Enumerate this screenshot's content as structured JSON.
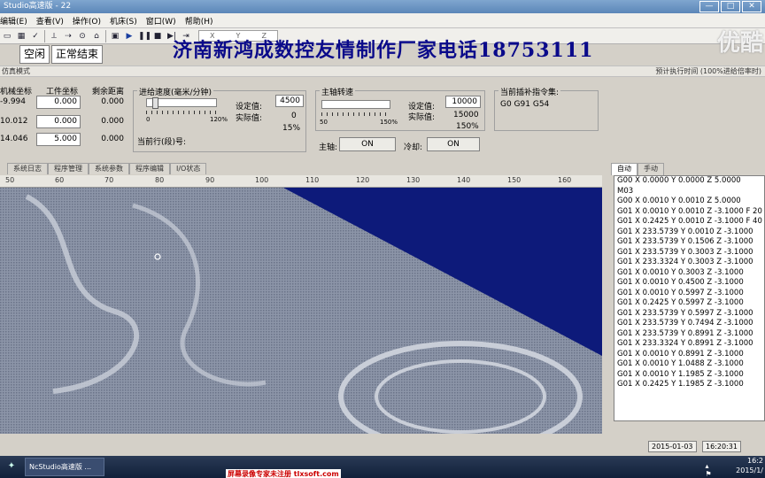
{
  "window": {
    "title": "Studio高速版 - 22",
    "buttons": [
      "—",
      "□",
      "✕"
    ]
  },
  "menu": [
    "编辑(E)",
    "查看(V)",
    "操作(O)",
    "机床(S)",
    "窗口(W)",
    "帮助(H)"
  ],
  "toolbar": {
    "xyz": [
      "X",
      "Y",
      "Z"
    ]
  },
  "status": {
    "idle": "空闲",
    "normal_end": "正常结束"
  },
  "banner": "济南新鸿成数控友情制作厂家电话18753111",
  "watermark": "优酷",
  "mode": {
    "label": "仿真模式",
    "estimate": "预计执行时间 (100%进给倍率时)"
  },
  "coords": {
    "headers": [
      "机械坐标",
      "工件坐标",
      "剩余距离"
    ],
    "rows": [
      {
        "mach": "-9.994",
        "work": "0.000",
        "remain": "0.000"
      },
      {
        "mach": "10.012",
        "work": "0.000",
        "remain": "0.000"
      },
      {
        "mach": "14.046",
        "work": "5.000",
        "remain": "0.000"
      }
    ]
  },
  "feed": {
    "title": "进给速度(毫米/分钟)",
    "set_label": "设定值:",
    "set_value": "4500",
    "actual_label": "实际值:",
    "actual_value": "0",
    "percent": "15%",
    "min": "0",
    "max": "120%",
    "current_line_label": "当前行(段)号:"
  },
  "spindle": {
    "title": "主轴转速",
    "set_label": "设定值:",
    "set_value": "10000",
    "actual_label": "实际值:",
    "actual_value": "15000",
    "percent": "150%",
    "min": "50",
    "max": "150%",
    "spindle_label": "主轴:",
    "spindle_btn": "ON",
    "cool_label": "冷却:",
    "cool_btn": "ON"
  },
  "interp": {
    "title": "当前插补指令集:",
    "value": "G0 G91 G54"
  },
  "tabs_left": [
    "系统日志",
    "程序管理",
    "系统参数",
    "程序编辑",
    "I/O状态"
  ],
  "tabs_right": [
    "自动",
    "手动"
  ],
  "ruler": [
    "50",
    "60",
    "70",
    "80",
    "90",
    "100",
    "110",
    "120",
    "130",
    "140",
    "150",
    "160"
  ],
  "gcode": [
    "G00 X 0.0000 Y 0.0000 Z 5.0000",
    "M03",
    "G00 X 0.0010 Y 0.0010 Z 5.0000",
    "G01 X 0.0010 Y 0.0010 Z -3.1000 F 20",
    "G01 X 0.2425 Y 0.0010 Z -3.1000 F 40",
    "G01 X 233.5739 Y 0.0010 Z -3.1000",
    "G01 X 233.5739 Y 0.1506 Z -3.1000",
    "G01 X 233.5739 Y 0.3003 Z -3.1000",
    "G01 X 233.3324 Y 0.3003 Z -3.1000",
    "G01 X 0.0010 Y 0.3003 Z -3.1000",
    "G01 X 0.0010 Y 0.4500 Z -3.1000",
    "G01 X 0.0010 Y 0.5997 Z -3.1000",
    "G01 X 0.2425 Y 0.5997 Z -3.1000",
    "G01 X 233.5739 Y 0.5997 Z -3.1000",
    "G01 X 233.5739 Y 0.7494 Z -3.1000",
    "G01 X 233.5739 Y 0.8991 Z -3.1000",
    "G01 X 233.3324 Y 0.8991 Z -3.1000",
    "G01 X 0.0010 Y 0.8991 Z -3.1000",
    "G01 X 0.0010 Y 1.0488 Z -3.1000",
    "G01 X 0.0010 Y 1.1985 Z -3.1000",
    "G01 X 0.2425 Y 1.1985 Z -3.1000"
  ],
  "footer": {
    "date": "2015-01-03",
    "time": "16:20:31"
  },
  "taskbar": {
    "app": "NcStudio高速版 ...",
    "notice": "屏幕录像专家未注册 tlxsoft.com",
    "clock_time": "16:2",
    "clock_date": "2015/1/"
  },
  "colors": {
    "viewport_bg": "#0d1a7a",
    "banner": "#0a0a8a"
  }
}
